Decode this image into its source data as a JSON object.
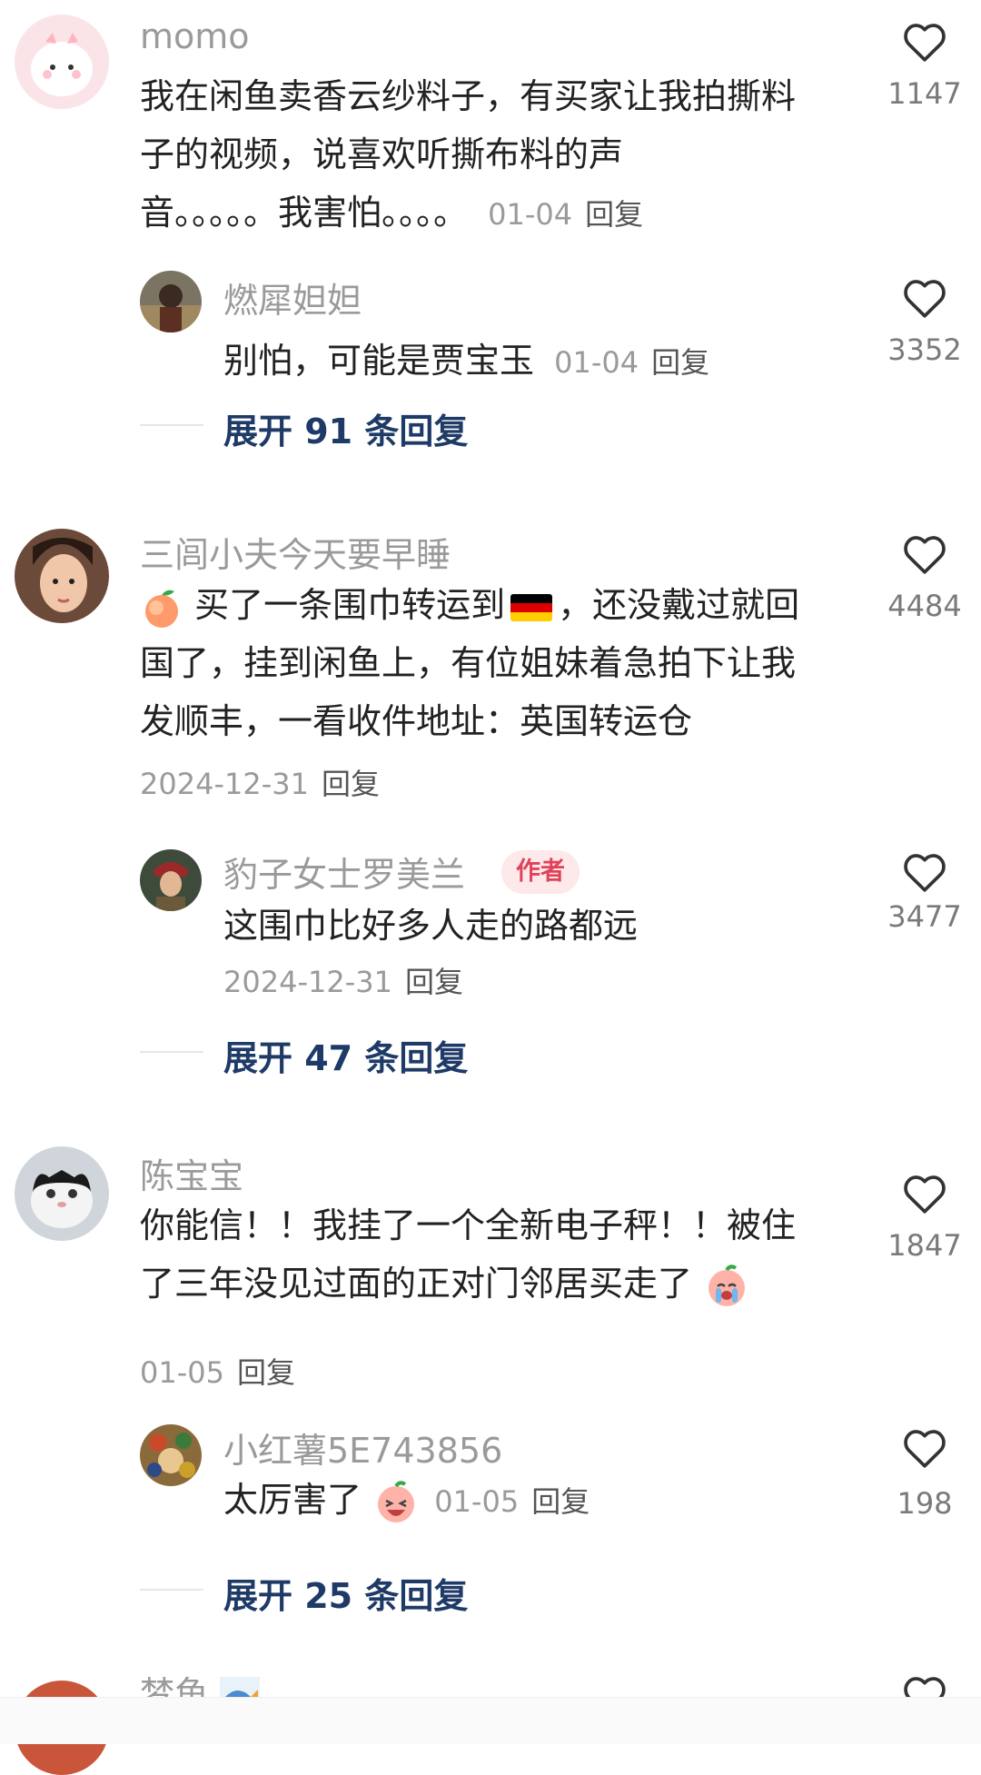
{
  "comments": [
    {
      "user": "momo",
      "text_lines": [
        "我在闲鱼卖香云纱料子，有买家让我拍撕料",
        "子的视频，说喜欢听撕布料的声",
        "音。。。。。我害怕。。。。"
      ],
      "date": "01-04",
      "reply_label": "回复",
      "likes": "1147",
      "reply": {
        "user": "燃犀妲妲",
        "text": "别怕，可能是贾宝玉",
        "date": "01-04",
        "reply_label": "回复",
        "likes": "3352"
      },
      "expand": "展开 91 条回复"
    },
    {
      "user": "三闾小夫今天要早睡",
      "text_lines": [
        "买了一条围巾转运到",
        "，还没戴过就回",
        "国了，挂到闲鱼上，有位姐妹着急拍下让我",
        "发顺丰，一看收件地址：英国转运仓"
      ],
      "date": "2024-12-31",
      "reply_label": "回复",
      "likes": "4484",
      "reply": {
        "user": "豹子女士罗美兰",
        "badge": "作者",
        "text": "这围巾比好多人走的路都远",
        "date": "2024-12-31",
        "reply_label": "回复",
        "likes": "3477"
      },
      "expand": "展开 47 条回复"
    },
    {
      "user": "陈宝宝",
      "text_lines": [
        "你能信！！我挂了一个全新电子秤！！被住",
        "了三年没见过面的正对门邻居买走了"
      ],
      "date": "01-05",
      "reply_label": "回复",
      "likes": "1847",
      "reply": {
        "user": "小红薯5E743856",
        "text": "太厉害了",
        "date": "01-05",
        "reply_label": "回复",
        "likes": "198"
      },
      "expand": "展开 25 条回复"
    },
    {
      "user": "梦鱼"
    }
  ],
  "icons": {
    "like": "heart-outline-icon",
    "peach": "peach-emoji",
    "flag": "germany-flag-emoji",
    "crying": "crying-emoji",
    "laughing": "laughing-emoji"
  },
  "colors": {
    "name": "#9a9a9a",
    "expand": "#1e3a66",
    "badge_bg": "#fde8ea",
    "badge_text": "#e0425a"
  }
}
